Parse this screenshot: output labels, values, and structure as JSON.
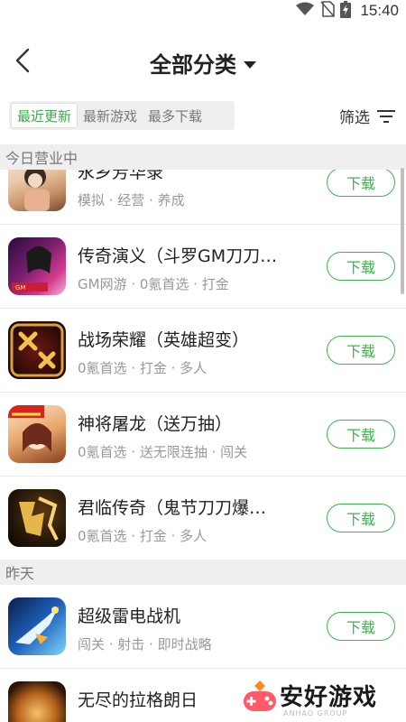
{
  "status_bar": {
    "time": "15:40"
  },
  "header": {
    "title": "全部分类"
  },
  "tabs": [
    {
      "label": "最近更新",
      "active": true
    },
    {
      "label": "最新游戏",
      "active": false
    },
    {
      "label": "最多下载",
      "active": false
    }
  ],
  "filter": {
    "label": "筛选"
  },
  "sections": [
    {
      "title": "今日营业中",
      "items": [
        {
          "name": "永乡芳华录",
          "tags": "模拟 · 经营 · 养成",
          "download": "下载"
        },
        {
          "name": "传奇演义（斗罗GM刀刀…",
          "tags": "GM网游 · 0氪首选 · 打金",
          "download": "下载"
        },
        {
          "name": "战场荣耀（英雄超变）",
          "tags": "0氪首选 · 打金 · 多人",
          "download": "下载"
        },
        {
          "name": "神将屠龙（送万抽）",
          "tags": "0氪首选 · 送无限连抽 · 闯关",
          "download": "下载"
        },
        {
          "name": "君临传奇（鬼节刀刀爆…",
          "tags": "0氪首选 · 打金 · 多人",
          "download": "下载"
        }
      ]
    },
    {
      "title": "昨天",
      "items": [
        {
          "name": "超级雷电战机",
          "tags": "闯关 · 射击 · 即时战略",
          "download": "下载"
        },
        {
          "name": "无尽的拉格朗日",
          "tags": "",
          "download": ""
        }
      ]
    }
  ],
  "watermark": {
    "text": "安好游戏",
    "sub": "ANHAO GROUP"
  },
  "colors": {
    "accent": "#3bb54a",
    "section_bg": "#efefef"
  }
}
